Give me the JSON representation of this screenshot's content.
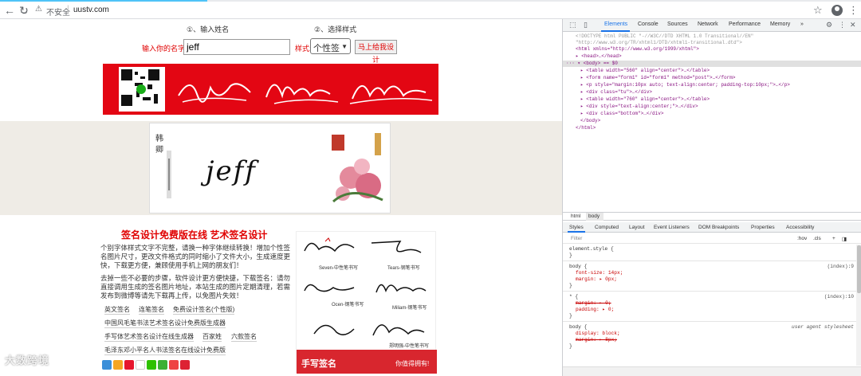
{
  "browser": {
    "insecure_label": "不安全",
    "separator": "|",
    "url": "uustv.com",
    "icons": {
      "back": "arrow-left-icon",
      "forward": "arrow-right-icon",
      "reload": "reload-icon",
      "warn": "warning-icon",
      "star": "star-icon",
      "account": "account-icon",
      "menu": "kebab-menu-icon"
    }
  },
  "page": {
    "step1": "①、输入姓名",
    "step2": "②、选择样式",
    "name_label": "输入你的名字:",
    "name_value": "jeff",
    "style_label": "样式:",
    "style_value": "个性签",
    "design_button": "马上给我设计",
    "preview_name": "jeff",
    "section_title": "签名设计免费版在线 艺术签名设计",
    "para1": "个别字体样式文字不完整，请换一种字体继续转换！增加个性签名图片尺寸，更改文件格式的同时缩小了文件大小，生成速度更快，下载更方便，兼顾使用手机上网的朋友们！",
    "para2": "去掉一些不必要的步骤，软件设计更方便快捷，下载签名：请勿直接调用生成的签名图片地址，本站生成的图片定期清理，若需发布到微博等请先下载再上传，以免图片失效！",
    "links": [
      "英文签名",
      "连笔签名",
      "免费设计签名(个性版)",
      "中国风毛笔书法艺术签名设计免费版生成器",
      "手写体艺术签名设计在线生成器",
      "百家姓",
      "六款签名",
      "毛泽东邓小平名人书法签名在线设计免费版"
    ],
    "sample_caps": [
      "Seven-中性笔书写",
      "Tears-钢笔书写",
      "Ocen-钢笔书写",
      "Miliam-钢笔书写",
      "郑明强-中性笔书写"
    ],
    "sample_footer_left": "手写签名",
    "sample_footer_right": "你值得拥有!",
    "watermark": "大数跨境"
  },
  "devtools": {
    "tabs": [
      "Elements",
      "Console",
      "Sources",
      "Network",
      "Performance",
      "Memory",
      "»"
    ],
    "dom_lines": [
      {
        "text": "<!DOCTYPE html PUBLIC \"-//W3C//DTD XHTML 1.0 Transitional//EN\"",
        "cls": "cmt"
      },
      {
        "text": "\"http://www.w3.org/TR/xhtml1/DTD/xhtml1-transitional.dtd\">",
        "cls": "cmt"
      },
      {
        "text": "<html xmlns=\"http://www.w3.org/1999/xhtml\">",
        "cls": "tag"
      },
      {
        "text": "▸ <head>…</head>",
        "cls": "tag"
      },
      {
        "text": "··· ▾ <body> == $0",
        "cls": "tag"
      },
      {
        "text": "▸ <table width=\"560\" align=\"center\">…</table>",
        "cls": "tag"
      },
      {
        "text": "▸ <form name=\"form1\" id=\"form1\" method=\"post\">…</form>",
        "cls": "tag"
      },
      {
        "text": "▸ <p style=\"margin:10px auto; text-align:center; padding-top:10px;\">…</p>",
        "cls": "tag"
      },
      {
        "text": "▸ <div class=\"tu\">…</div>",
        "cls": "tag"
      },
      {
        "text": "▸ <table width=\"760\" align=\"center\">…</table>",
        "cls": "tag"
      },
      {
        "text": "▸ <div style=\"text-align:center;\">…</div>",
        "cls": "tag"
      },
      {
        "text": "▸ <div class=\"bottom\">…</div>",
        "cls": "tag"
      },
      {
        "text": "</body>",
        "cls": "tag"
      },
      {
        "text": "</html>",
        "cls": "tag"
      }
    ],
    "crumbs": [
      "html",
      "body"
    ],
    "styles_tabs": [
      "Styles",
      "Computed",
      "Layout",
      "Event Listeners",
      "DOM Breakpoints",
      "Properties",
      "Accessibility"
    ],
    "filter_placeholder": "Filter",
    "filter_hov": ":hov",
    "filter_cls": ".cls",
    "rules": {
      "element_style": "element.style {",
      "element_close": "}",
      "body_selector": "body {",
      "body_src": "(index):9",
      "body_p1": "font-size: 14px;",
      "body_p2": "margin: ▸ 0px;",
      "body_close": "}",
      "star_selector": "* {",
      "star_src": "(index):10",
      "star_p1": "margin: ▸ 0;",
      "star_p2": "padding: ▸ 0;",
      "star_close": "}",
      "ua_selector": "body {",
      "ua_src": "user agent stylesheet",
      "ua_p1": "display: block;",
      "ua_p2": "margin: ▸ 8px;",
      "ua_close": "}"
    }
  },
  "colors": {
    "accent_red": "#e00000",
    "banner_red": "#e30613",
    "devtools_blue": "#1a73e8"
  }
}
